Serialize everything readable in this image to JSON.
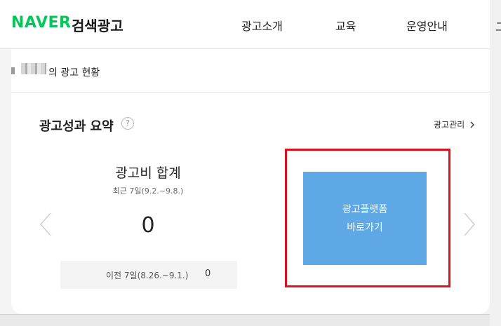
{
  "header": {
    "logo": "NAVER",
    "logo_sub": "검색광고",
    "nav": [
      {
        "label": "광고소개"
      },
      {
        "label": "교육"
      },
      {
        "label": "운영안내"
      }
    ]
  },
  "status": {
    "text": "의 광고 현황"
  },
  "summary": {
    "title": "광고성과 요약",
    "help": "?",
    "manage_link": "광고관리"
  },
  "cost": {
    "title": "광고비 합계",
    "period": "최근 7일(9.2.~9.8.)",
    "value": "0",
    "prev_label": "이전 7일(8.26.~9.1.)",
    "prev_value": "0"
  },
  "platform_button": {
    "line1": "광고플랫폼",
    "line2": "바로가기"
  },
  "colors": {
    "brand_green": "#03c75a",
    "button_blue": "#5ea8e6",
    "highlight_red": "#e0101f"
  },
  "right_edge_char": "그"
}
